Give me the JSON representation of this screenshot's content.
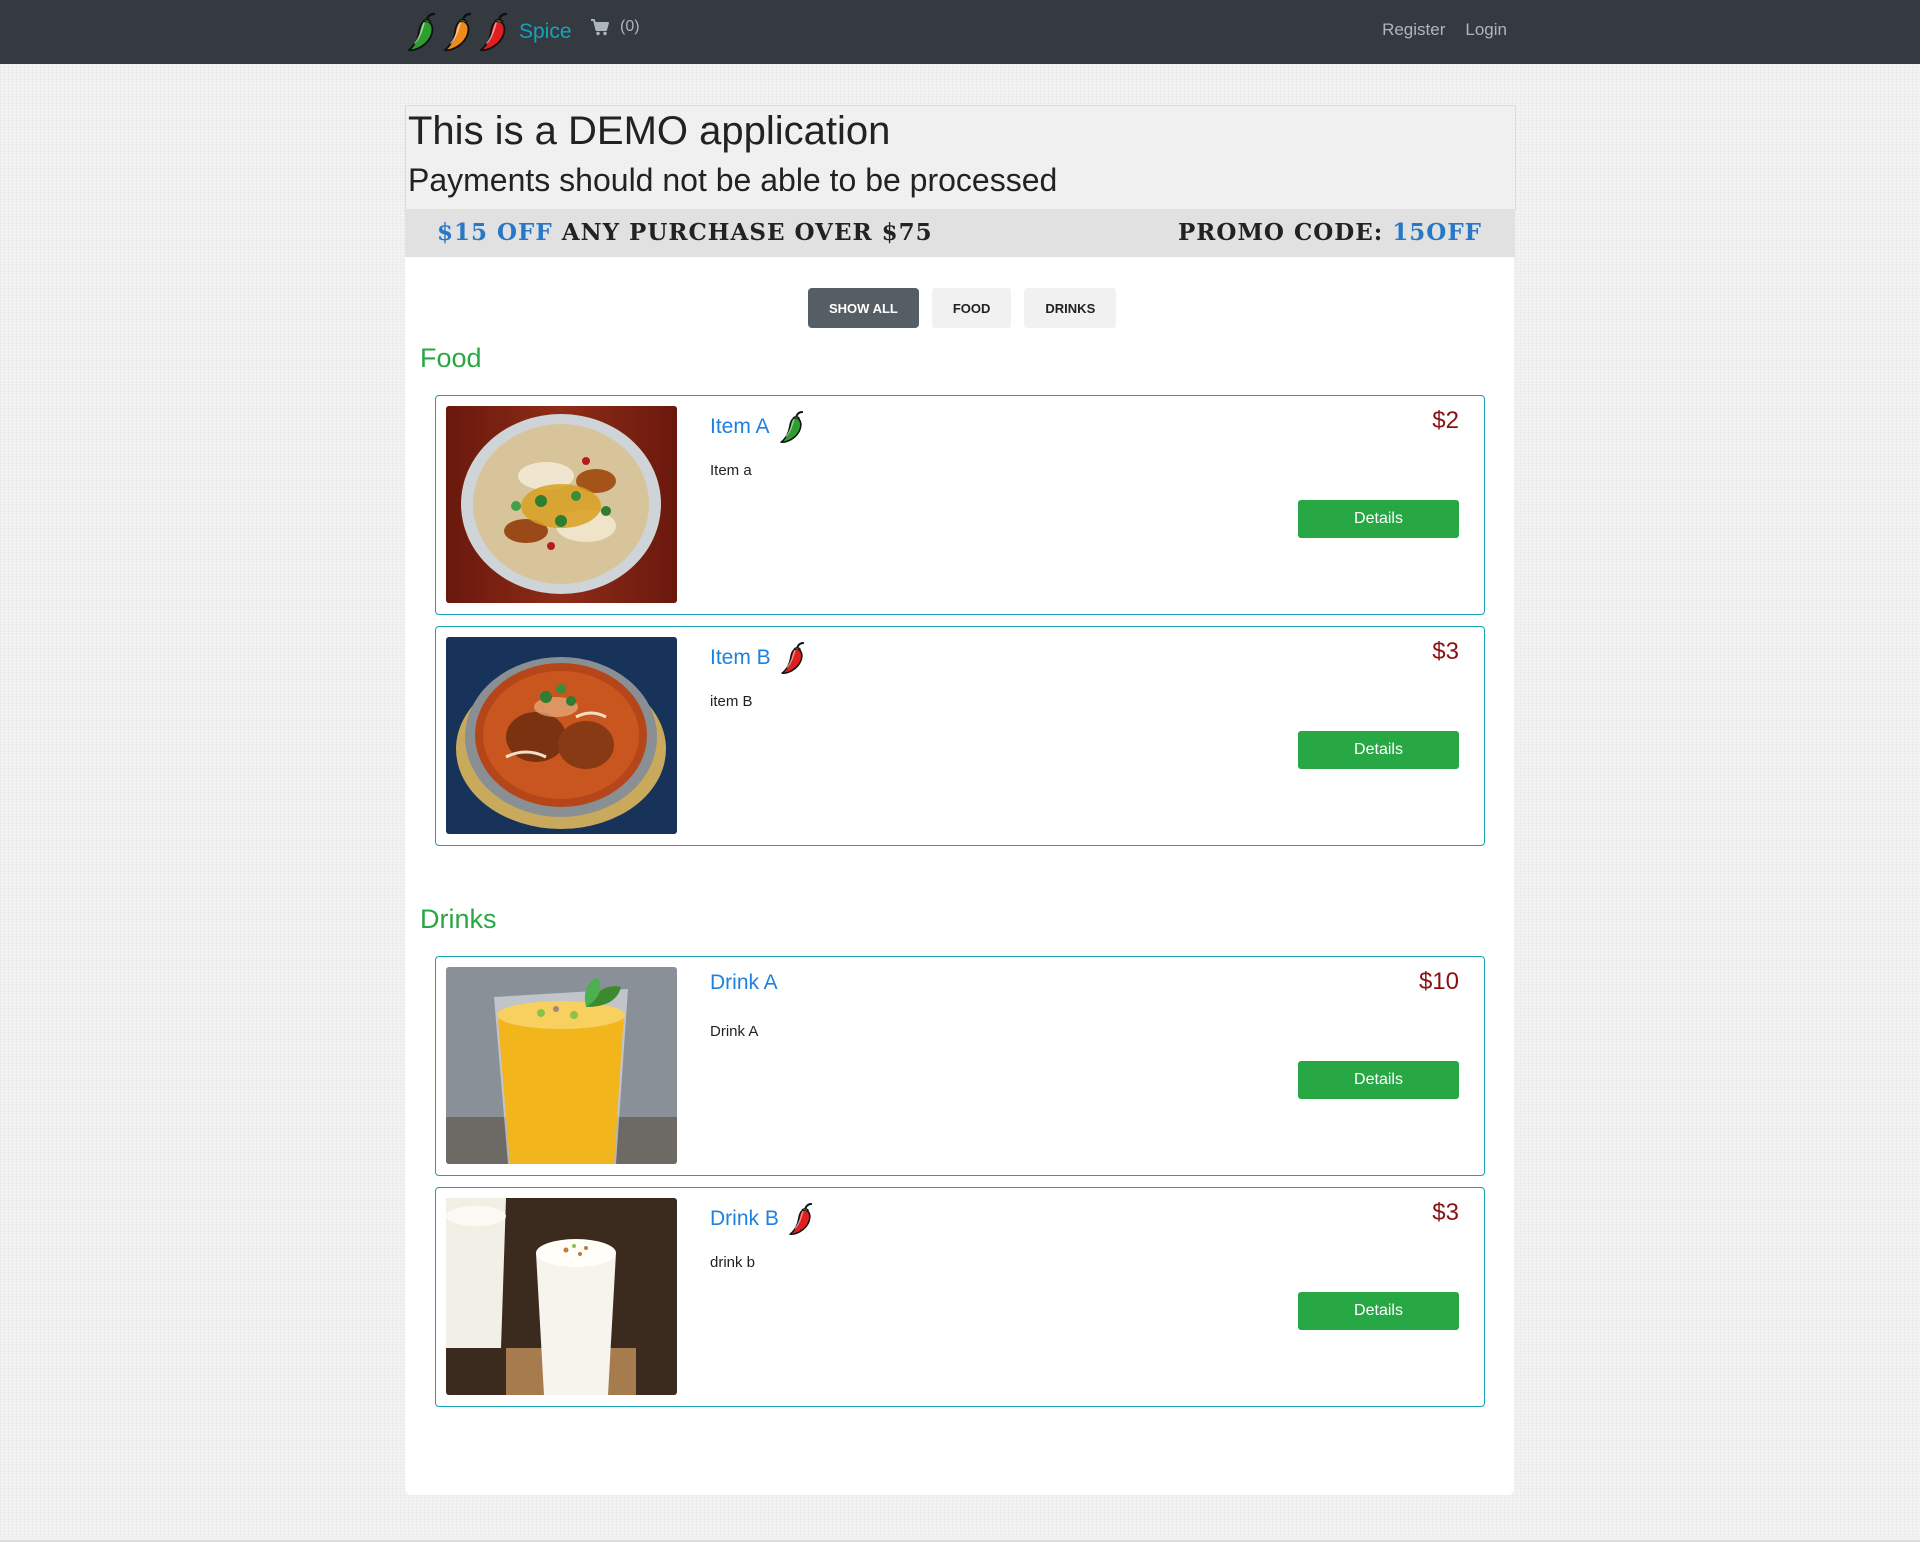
{
  "navbar": {
    "brand": "Spice",
    "brand_peppers": [
      "green-pepper-icon",
      "orange-pepper-icon",
      "red-pepper-icon"
    ],
    "cart_count": "(0)",
    "cart_icon": "cart-icon",
    "register": "Register",
    "login": "Login"
  },
  "banner": {
    "title": "This is a DEMO application",
    "subtitle": "Payments should not be able to be processed"
  },
  "promo": {
    "amount": "$15 OFF",
    "text": "ANY PURCHASE OVER $75",
    "code_label": "PROMO CODE:",
    "code": "15OFF"
  },
  "filters": [
    "SHOW ALL",
    "FOOD",
    "DRINKS"
  ],
  "active_filter": "SHOW ALL",
  "sections": [
    {
      "title": "Food",
      "items": [
        {
          "name": "Item A",
          "desc": "Item a",
          "price": "$2",
          "spice_icon": "green-pepper-icon",
          "image": "food-image",
          "button": "Details"
        },
        {
          "name": "Item B",
          "desc": "item B",
          "price": "$3",
          "spice_icon": "red-pepper-icon",
          "image": "curry-image",
          "button": "Details"
        }
      ]
    },
    {
      "title": "Drinks",
      "items": [
        {
          "name": "Drink A",
          "desc": "Drink A",
          "price": "$10",
          "spice_icon": "",
          "image": "mango-lassi-image",
          "button": "Details"
        },
        {
          "name": "Drink B",
          "desc": "drink b",
          "price": "$3",
          "spice_icon": "red-pepper-icon",
          "image": "lassi-image",
          "button": "Details"
        }
      ]
    }
  ],
  "colors": {
    "navbar": "#343a40",
    "brand": "#17a2b8",
    "section_title": "#28a745",
    "item_name": "#1e80e0",
    "price": "#8b1010",
    "details_button": "#28a745",
    "card_border": "#17a2b8",
    "promo_blue": "#2878c8",
    "green_pepper": "#2e9e2e",
    "orange_pepper": "#f08a1c",
    "red_pepper": "#e02020"
  }
}
